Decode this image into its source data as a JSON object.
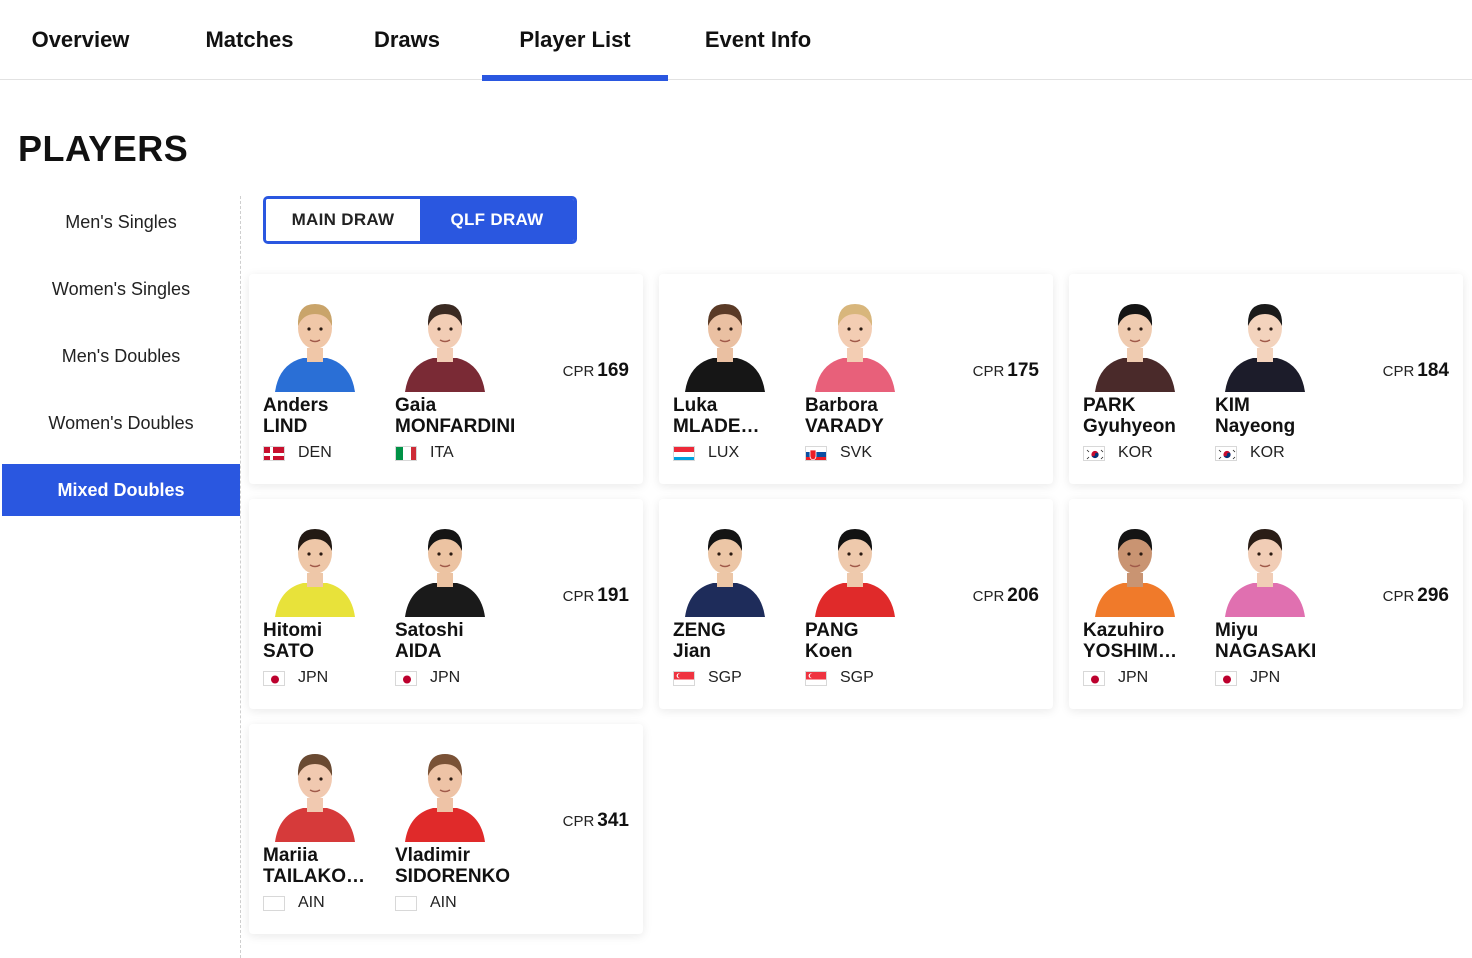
{
  "tabs": [
    {
      "label": "Overview",
      "active": false
    },
    {
      "label": "Matches",
      "active": false
    },
    {
      "label": "Draws",
      "active": false
    },
    {
      "label": "Player List",
      "active": true
    },
    {
      "label": "Event Info",
      "active": false
    }
  ],
  "page_title": "PLAYERS",
  "sidebar": {
    "items": [
      {
        "label": "Men's Singles",
        "active": false
      },
      {
        "label": "Women's Singles",
        "active": false
      },
      {
        "label": "Men's Doubles",
        "active": false
      },
      {
        "label": "Women's Doubles",
        "active": false
      },
      {
        "label": "Mixed Doubles",
        "active": true
      }
    ]
  },
  "draw_toggle": {
    "main_label": "MAIN DRAW",
    "qlf_label": "QLF DRAW",
    "selected": "QLF DRAW"
  },
  "cpr_label": "CPR",
  "pairs": [
    {
      "cpr": "169",
      "players": [
        {
          "first": "Anders",
          "last": "LIND",
          "country": "DEN",
          "flag": "den",
          "shirt": "#2a6fd6",
          "skin": "#f0c7a8",
          "hair": "#c9a46a"
        },
        {
          "first": "Gaia",
          "last": "MONFARDINI",
          "country": "ITA",
          "flag": "ita",
          "shirt": "#7a2a35",
          "skin": "#f2cdb5",
          "hair": "#3a2a22"
        }
      ]
    },
    {
      "cpr": "175",
      "players": [
        {
          "first": "Luka",
          "last": "MLADE…",
          "country": "LUX",
          "flag": "lux",
          "shirt": "#161616",
          "skin": "#eac0a2",
          "hair": "#5a3a26"
        },
        {
          "first": "Barbora",
          "last": "VARADY",
          "country": "SVK",
          "flag": "svk",
          "shirt": "#e8607a",
          "skin": "#f3cdb3",
          "hair": "#d8b67c"
        }
      ]
    },
    {
      "cpr": "184",
      "players": [
        {
          "first": "PARK",
          "last": "Gyuhyeon",
          "country": "KOR",
          "flag": "kor",
          "shirt": "#4a2a2a",
          "skin": "#efcbb0",
          "hair": "#141414"
        },
        {
          "first": "KIM",
          "last": "Nayeong",
          "country": "KOR",
          "flag": "kor",
          "shirt": "#1c1c2a",
          "skin": "#f3d3bd",
          "hair": "#1a1a1a"
        }
      ]
    },
    {
      "cpr": "191",
      "players": [
        {
          "first": "Hitomi",
          "last": "SATO",
          "country": "JPN",
          "flag": "jpn",
          "shirt": "#e8e23a",
          "skin": "#eec7a8",
          "hair": "#231a14"
        },
        {
          "first": "Satoshi",
          "last": "AIDA",
          "country": "JPN",
          "flag": "jpn",
          "shirt": "#1a1a1a",
          "skin": "#ecc3a2",
          "hair": "#151515"
        }
      ]
    },
    {
      "cpr": "206",
      "players": [
        {
          "first": "ZENG",
          "last": "Jian",
          "country": "SGP",
          "flag": "sgp",
          "shirt": "#1e2c5a",
          "skin": "#ecc6a6",
          "hair": "#141414"
        },
        {
          "first": "PANG",
          "last": "Koen",
          "country": "SGP",
          "flag": "sgp",
          "shirt": "#e02a2a",
          "skin": "#eec9ac",
          "hair": "#121212"
        }
      ]
    },
    {
      "cpr": "296",
      "players": [
        {
          "first": "Kazuhiro",
          "last": "YOSHIM…",
          "country": "JPN",
          "flag": "jpn",
          "shirt": "#f07a2a",
          "skin": "#c99472",
          "hair": "#141414"
        },
        {
          "first": "Miyu",
          "last": "NAGASAKI",
          "country": "JPN",
          "flag": "jpn",
          "shirt": "#e070b0",
          "skin": "#f1cdb6",
          "hair": "#2a1d16"
        }
      ]
    },
    {
      "cpr": "341",
      "players": [
        {
          "first": "Mariia",
          "last": "TAILAKO…",
          "country": "AIN",
          "flag": "ain",
          "shirt": "#d63a3a",
          "skin": "#f1c9b0",
          "hair": "#6a4a32"
        },
        {
          "first": "Vladimir",
          "last": "SIDORENKO",
          "country": "AIN",
          "flag": "ain",
          "shirt": "#e02a2a",
          "skin": "#eec3a6",
          "hair": "#7a5236"
        }
      ]
    }
  ]
}
